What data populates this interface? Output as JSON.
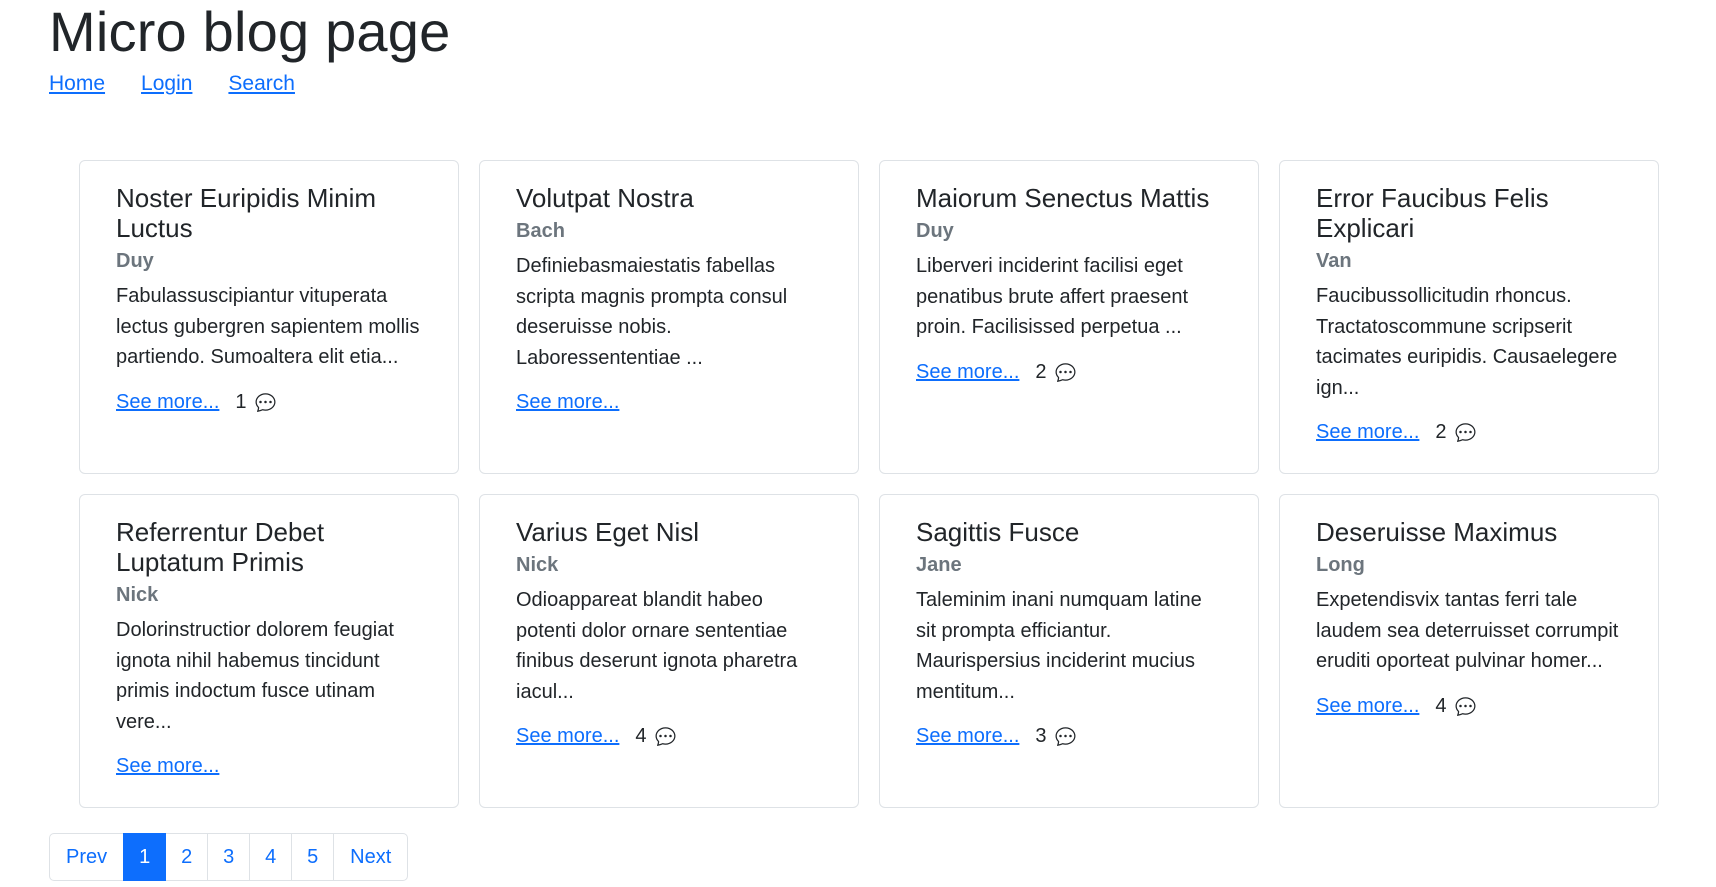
{
  "page": {
    "title": "Micro blog page"
  },
  "nav": {
    "items": [
      {
        "label": "Home"
      },
      {
        "label": "Login"
      },
      {
        "label": "Search"
      }
    ]
  },
  "posts": [
    {
      "title": "Noster Euripidis Minim Luctus",
      "author": "Duy",
      "excerpt": "Fabulassuscipiantur vituperata lectus gubergren sapientem mollis partiendo. Sumoaltera elit etia...",
      "see_more": "See more...",
      "comments": "1",
      "comment_icon": "chat-bubble-icon"
    },
    {
      "title": "Volutpat Nostra",
      "author": "Bach",
      "excerpt": "Definiebasmaiestatis fabellas scripta magnis prompta consul deseruisse nobis. Laboressententiae ...",
      "see_more": "See more..."
    },
    {
      "title": "Maiorum Senectus Mattis",
      "author": "Duy",
      "excerpt": "Liberveri inciderint facilisi eget penatibus brute affert praesent proin. Facilisissed perpetua ...",
      "see_more": "See more...",
      "comments": "2",
      "comment_icon": "chat-bubble-icon"
    },
    {
      "title": "Error Faucibus Felis Explicari",
      "author": "Van",
      "excerpt": "Faucibussollicitudin rhoncus. Tractatoscommune scripserit tacimates euripidis. Causaelegere ign...",
      "see_more": "See more...",
      "comments": "2",
      "comment_icon": "chat-bubble-icon"
    },
    {
      "title": "Referrentur Debet Luptatum Primis",
      "author": "Nick",
      "excerpt": "Dolorinstructior dolorem feugiat ignota nihil habemus tincidunt primis indoctum fusce utinam vere...",
      "see_more": "See more..."
    },
    {
      "title": "Varius Eget Nisl",
      "author": "Nick",
      "excerpt": "Odioappareat blandit habeo potenti dolor ornare sententiae finibus deserunt ignota pharetra iacul...",
      "see_more": "See more...",
      "comments": "4",
      "comment_icon": "chat-bubble-icon"
    },
    {
      "title": "Sagittis Fusce",
      "author": "Jane",
      "excerpt": "Taleminim inani numquam latine sit prompta efficiantur. Maurispersius inciderint mucius mentitum...",
      "see_more": "See more...",
      "comments": "3",
      "comment_icon": "chat-bubble-icon"
    },
    {
      "title": "Deseruisse Maximus",
      "author": "Long",
      "excerpt": "Expetendisvix tantas ferri tale laudem sea deterruisset corrumpit eruditi oporteat pulvinar homer...",
      "see_more": "See more...",
      "comments": "4",
      "comment_icon": "chat-bubble-icon"
    }
  ],
  "pagination": {
    "prev": "Prev",
    "next": "Next",
    "pages": [
      "1",
      "2",
      "3",
      "4",
      "5"
    ],
    "active_page": "1"
  },
  "colors": {
    "link": "#0d6efd",
    "muted": "#6c757d",
    "text": "#212529",
    "border": "#dee2e6",
    "active_bg": "#0d6efd"
  }
}
